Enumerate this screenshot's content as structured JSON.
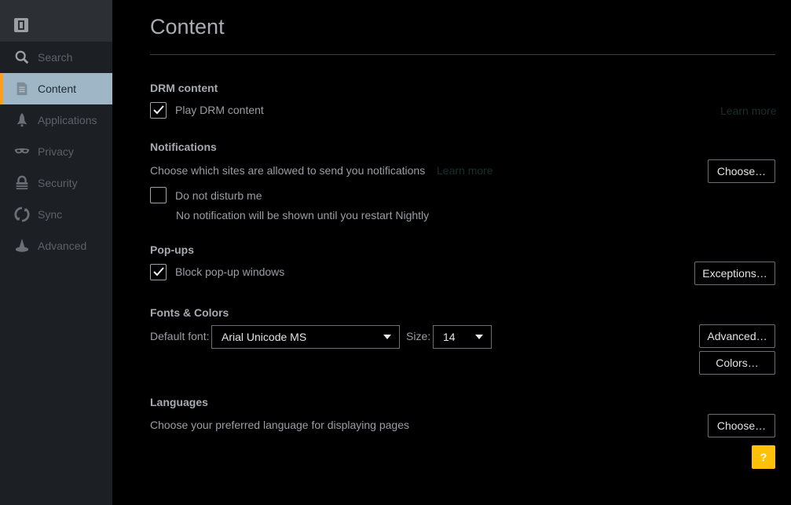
{
  "sidebar": {
    "items": [
      {
        "label": "Search",
        "icon": "search-icon"
      },
      {
        "label": "Content",
        "icon": "document-icon",
        "active": true
      },
      {
        "label": "Applications",
        "icon": "rocket-icon"
      },
      {
        "label": "Privacy",
        "icon": "mask-icon"
      },
      {
        "label": "Security",
        "icon": "lock-icon"
      },
      {
        "label": "Sync",
        "icon": "sync-icon"
      },
      {
        "label": "Advanced",
        "icon": "wizard-icon"
      }
    ],
    "accent_color": "#ff9f1c",
    "active_bg": "#9fb6c7"
  },
  "page": {
    "title": "Content"
  },
  "drm": {
    "heading": "DRM content",
    "checkbox_label": "Play DRM content",
    "checked": true,
    "learn_more": "Learn more"
  },
  "notifications": {
    "heading": "Notifications",
    "description": "Choose which sites are allowed to send you notifications",
    "learn_more": "Learn more",
    "choose_button": "Choose…",
    "dnd_label": "Do not disturb me",
    "dnd_checked": false,
    "dnd_note": "No notification will be shown until you restart Nightly"
  },
  "popups": {
    "heading": "Pop-ups",
    "checkbox_label": "Block pop-up windows",
    "checked": true,
    "exceptions_button": "Exceptions…"
  },
  "fonts": {
    "heading": "Fonts & Colors",
    "default_font_label": "Default font:",
    "default_font_value": "Arial Unicode MS",
    "size_label": "Size:",
    "size_value": "14",
    "advanced_button": "Advanced…",
    "colors_button": "Colors…"
  },
  "languages": {
    "heading": "Languages",
    "description": "Choose your preferred language for displaying pages",
    "choose_button": "Choose…"
  },
  "help": {
    "label": "?"
  }
}
